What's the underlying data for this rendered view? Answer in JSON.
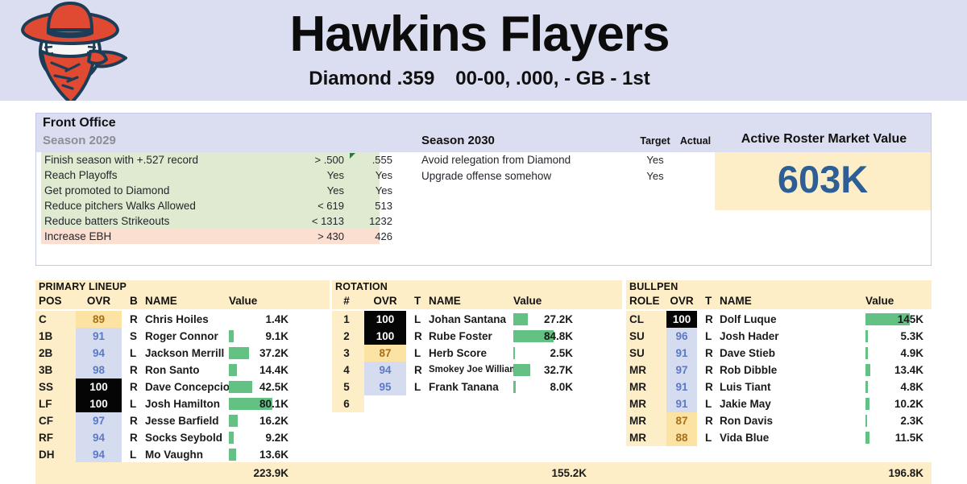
{
  "header": {
    "logo_name": "bandit-baseball-logo",
    "team_name": "Hawkins Flayers",
    "league": "Diamond .359",
    "record": "00-00, .000, - GB - 1st"
  },
  "front_office": {
    "panel_title": "Front Office",
    "previous_season_label": "Season 2029",
    "current_season_label": "Season 2030",
    "col_target": "Target",
    "col_actual": "Actual",
    "previous_goals": [
      {
        "label": "Finish season with +.527 record",
        "target": "> .500",
        "actual": ".555",
        "met": true,
        "flag": true
      },
      {
        "label": "Reach Playoffs",
        "target": "Yes",
        "actual": "Yes",
        "met": true,
        "flag": false
      },
      {
        "label": "Get promoted to Diamond",
        "target": "Yes",
        "actual": "Yes",
        "met": true,
        "flag": false
      },
      {
        "label": "Reduce pitchers Walks Allowed",
        "target": "< 619",
        "actual": "513",
        "met": true,
        "flag": false
      },
      {
        "label": "Reduce batters Strikeouts",
        "target": "< 1313",
        "actual": "1232",
        "met": true,
        "flag": false
      },
      {
        "label": "Increase EBH",
        "target": "> 430",
        "actual": "426",
        "met": false,
        "flag": false
      }
    ],
    "current_goals": [
      {
        "label": "Avoid relegation from Diamond",
        "target": "Yes",
        "actual": ""
      },
      {
        "label": "Upgrade offense somehow",
        "target": "Yes",
        "actual": ""
      }
    ],
    "market_value": {
      "title": "Active Roster Market Value",
      "value": "603K"
    }
  },
  "roster": {
    "lineup": {
      "title": "PRIMARY LINEUP",
      "columns": [
        "POS",
        "OVR",
        "B",
        "NAME",
        "Value"
      ],
      "rows": [
        {
          "pos": "C",
          "ovr": "89",
          "tier": "t80",
          "hand": "R",
          "name": "Chris Hoiles",
          "value": "1.4K",
          "bar": 0
        },
        {
          "pos": "1B",
          "ovr": "91",
          "tier": "t90",
          "hand": "S",
          "name": "Roger Connor",
          "value": "9.1K",
          "bar": 6
        },
        {
          "pos": "2B",
          "ovr": "94",
          "tier": "t90",
          "hand": "L",
          "name": "Jackson Merrill",
          "value": "37.2K",
          "bar": 25
        },
        {
          "pos": "3B",
          "ovr": "98",
          "tier": "t90",
          "hand": "R",
          "name": "Ron Santo",
          "value": "14.4K",
          "bar": 10
        },
        {
          "pos": "SS",
          "ovr": "100",
          "tier": "t100",
          "hand": "R",
          "name": "Dave Concepcion",
          "value": "42.5K",
          "bar": 29
        },
        {
          "pos": "LF",
          "ovr": "100",
          "tier": "t100",
          "hand": "L",
          "name": "Josh Hamilton",
          "value": "80.1K",
          "bar": 54
        },
        {
          "pos": "CF",
          "ovr": "97",
          "tier": "t90",
          "hand": "R",
          "name": "Jesse Barfield",
          "value": "16.2K",
          "bar": 11
        },
        {
          "pos": "RF",
          "ovr": "94",
          "tier": "t90",
          "hand": "R",
          "name": "Socks Seybold",
          "value": "9.2K",
          "bar": 6
        },
        {
          "pos": "DH",
          "ovr": "94",
          "tier": "t90",
          "hand": "L",
          "name": "Mo Vaughn",
          "value": "13.6K",
          "bar": 9
        }
      ],
      "total": "223.9K"
    },
    "rotation": {
      "title": "ROTATION",
      "columns": [
        "#",
        "OVR",
        "T",
        "NAME",
        "Value"
      ],
      "rows": [
        {
          "pos": "1",
          "ovr": "100",
          "tier": "t100",
          "hand": "L",
          "name": "Johan Santana",
          "value": "27.2K",
          "bar": 18,
          "small": false
        },
        {
          "pos": "2",
          "ovr": "100",
          "tier": "t100",
          "hand": "R",
          "name": "Rube Foster",
          "value": "84.8K",
          "bar": 50,
          "small": false
        },
        {
          "pos": "3",
          "ovr": "87",
          "tier": "t80",
          "hand": "L",
          "name": "Herb Score",
          "value": "2.5K",
          "bar": 2,
          "small": false
        },
        {
          "pos": "4",
          "ovr": "94",
          "tier": "t90",
          "hand": "R",
          "name": "Smokey Joe Williams",
          "value": "32.7K",
          "bar": 21,
          "small": true
        },
        {
          "pos": "5",
          "ovr": "95",
          "tier": "t90",
          "hand": "L",
          "name": "Frank Tanana",
          "value": "8.0K",
          "bar": 3,
          "small": false
        },
        {
          "pos": "6",
          "ovr": "",
          "tier": "",
          "hand": "",
          "name": "",
          "value": "",
          "bar": 0,
          "small": false
        }
      ],
      "total": "155.2K"
    },
    "bullpen": {
      "title": "BULLPEN",
      "columns": [
        "ROLE",
        "OVR",
        "T",
        "NAME",
        "Value"
      ],
      "rows": [
        {
          "pos": "CL",
          "ovr": "100",
          "tier": "t100",
          "hand": "R",
          "name": "Dolf Luque",
          "value": "145K",
          "bar": 55
        },
        {
          "pos": "SU",
          "ovr": "96",
          "tier": "t90",
          "hand": "L",
          "name": "Josh Hader",
          "value": "5.3K",
          "bar": 3
        },
        {
          "pos": "SU",
          "ovr": "91",
          "tier": "t90",
          "hand": "R",
          "name": "Dave Stieb",
          "value": "4.9K",
          "bar": 3
        },
        {
          "pos": "MR",
          "ovr": "97",
          "tier": "t90",
          "hand": "R",
          "name": "Rob Dibble",
          "value": "13.4K",
          "bar": 6
        },
        {
          "pos": "MR",
          "ovr": "91",
          "tier": "t90",
          "hand": "R",
          "name": "Luis Tiant",
          "value": "4.8K",
          "bar": 3
        },
        {
          "pos": "MR",
          "ovr": "91",
          "tier": "t90",
          "hand": "L",
          "name": "Jakie May",
          "value": "10.2K",
          "bar": 5
        },
        {
          "pos": "MR",
          "ovr": "87",
          "tier": "t80",
          "hand": "R",
          "name": "Ron Davis",
          "value": "2.3K",
          "bar": 2
        },
        {
          "pos": "MR",
          "ovr": "88",
          "tier": "t80",
          "hand": "L",
          "name": "Vida Blue",
          "value": "11.5K",
          "bar": 5
        }
      ],
      "total": "196.8K"
    }
  },
  "colors": {
    "header_bg": "#dbdef0",
    "cream": "#fdeec8",
    "goal_met": "#dfead0",
    "goal_missed": "#fbdfd1",
    "bar_green": "#63c183",
    "tier_elite": "#050505",
    "tier_high": "#d6dcf0",
    "tier_mid": "#fce3a4",
    "market_value_text": "#2e5f94"
  }
}
